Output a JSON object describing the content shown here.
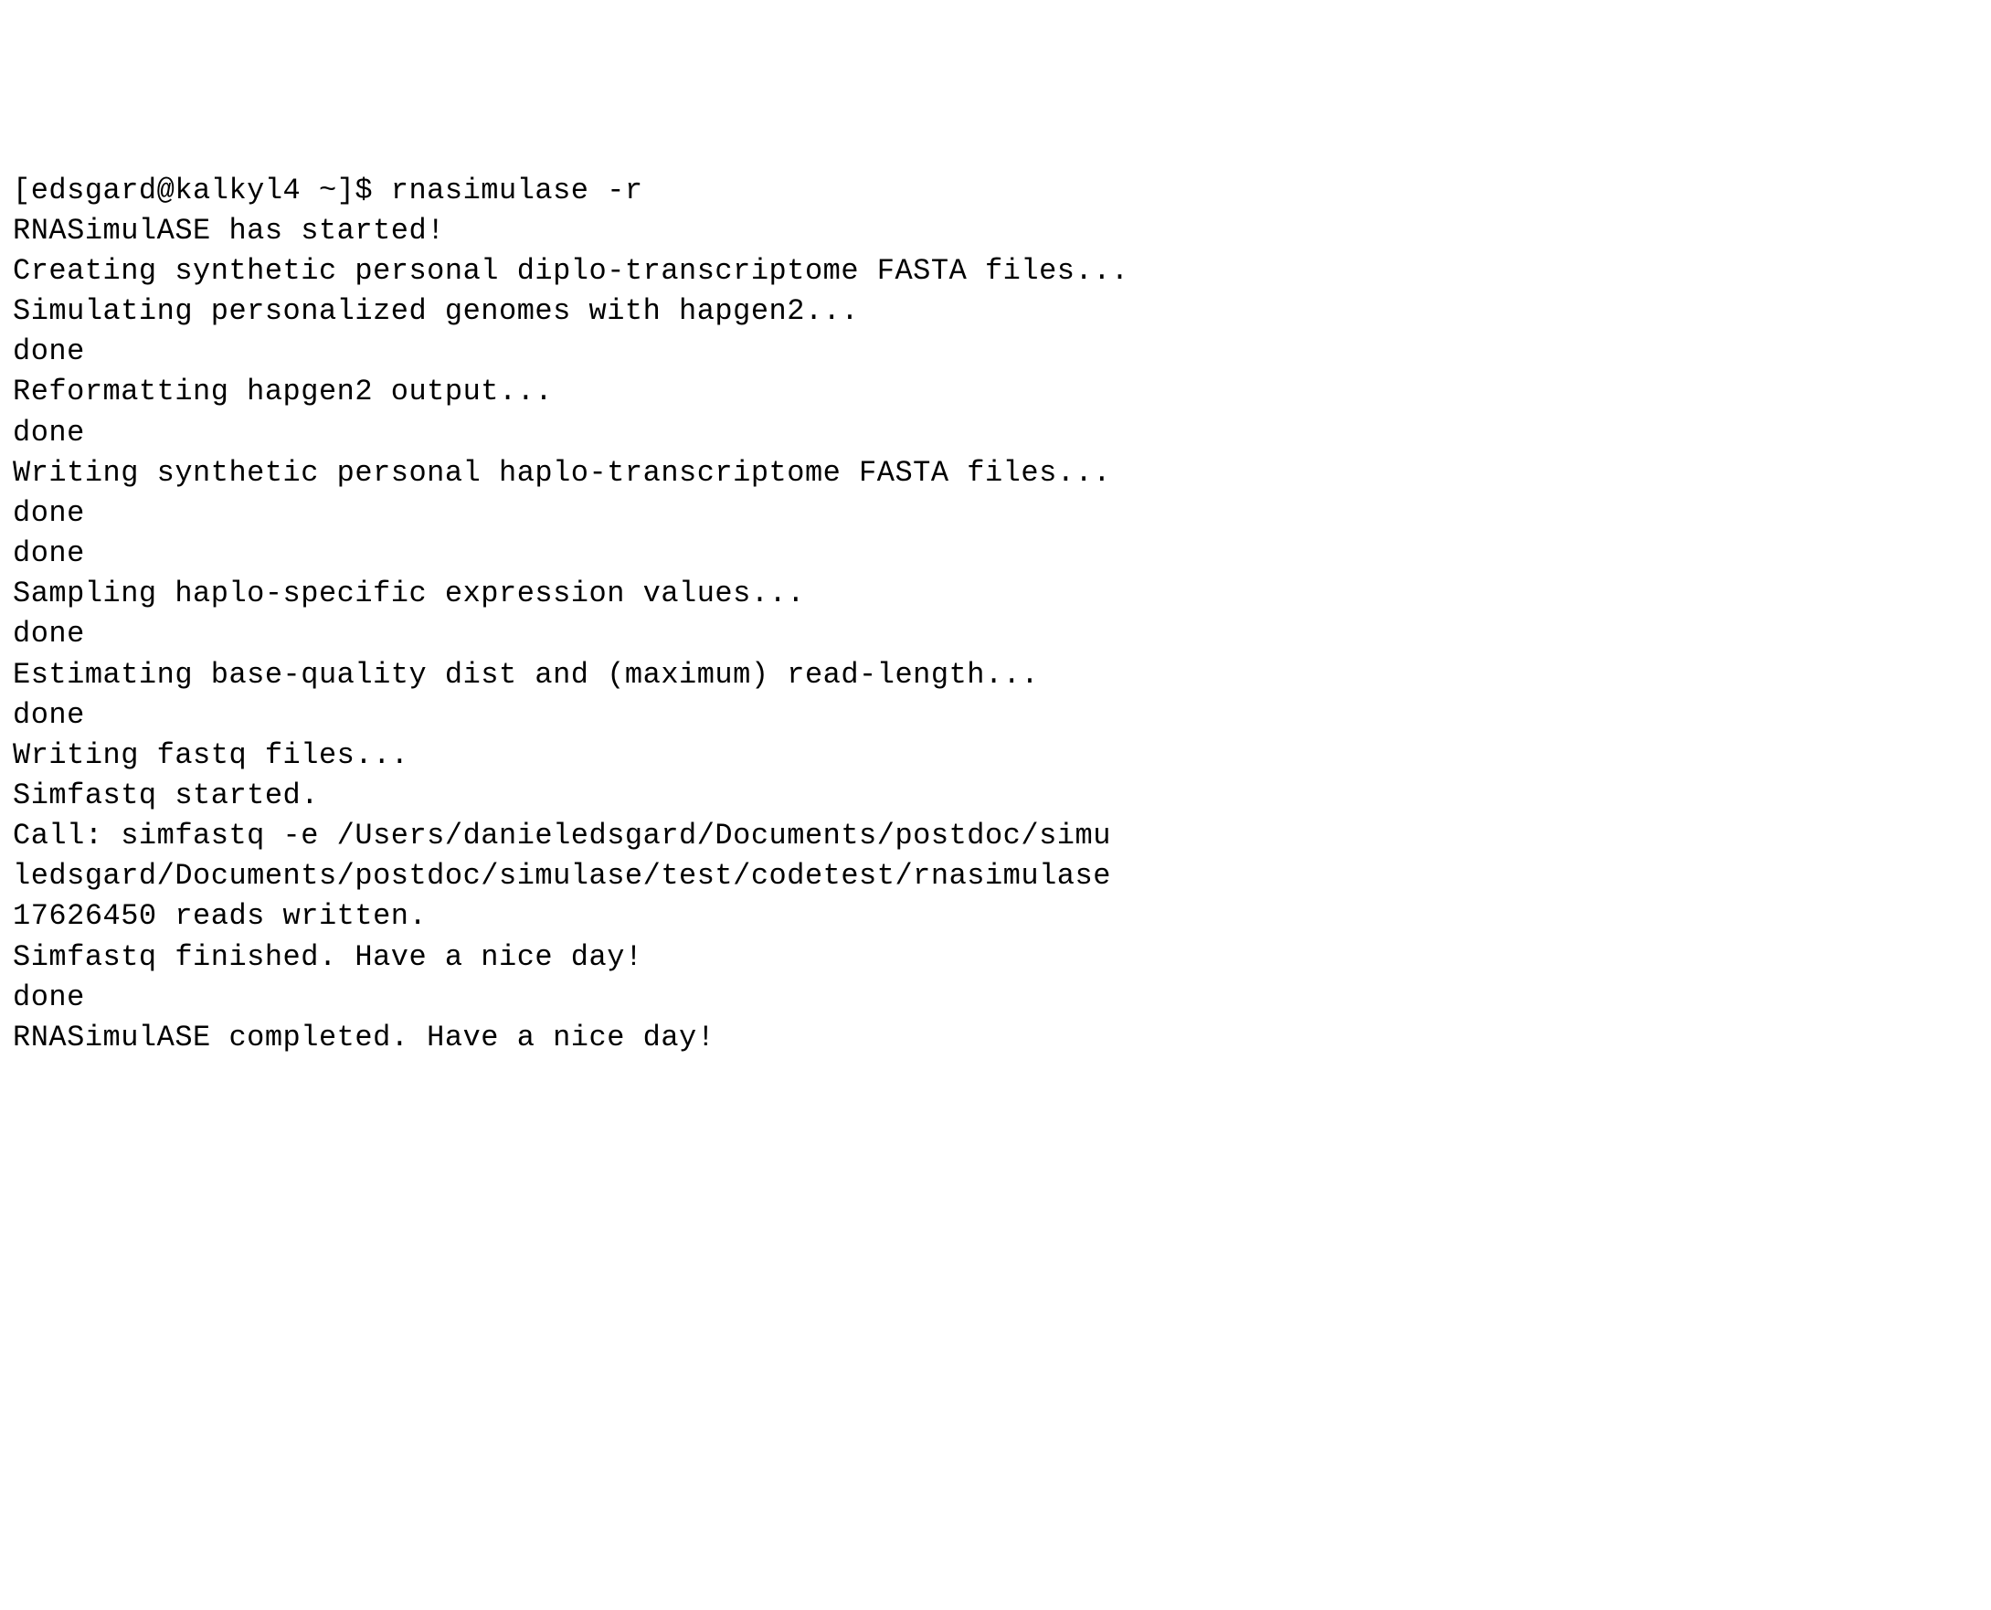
{
  "terminal": {
    "prompt": "[edsgard@kalkyl4 ~]$ ",
    "command": "rnasimulase -r",
    "lines": [
      "RNASimulASE has started!",
      "Creating synthetic personal diplo-transcriptome FASTA files...",
      "Simulating personalized genomes with hapgen2...",
      "done",
      "Reformatting hapgen2 output...",
      "done",
      "Writing synthetic personal haplo-transcriptome FASTA files...",
      "done",
      "done",
      "Sampling haplo-specific expression values...",
      "done",
      "Estimating base-quality dist and (maximum) read-length...",
      "done",
      "Writing fastq files...",
      "Simfastq started.",
      "Call: simfastq -e /Users/danieledsgard/Documents/postdoc/simu",
      "ledsgard/Documents/postdoc/simulase/test/codetest/rnasimulase",
      "17626450 reads written.",
      "Simfastq finished. Have a nice day!",
      "done",
      "RNASimulASE completed. Have a nice day!"
    ]
  }
}
